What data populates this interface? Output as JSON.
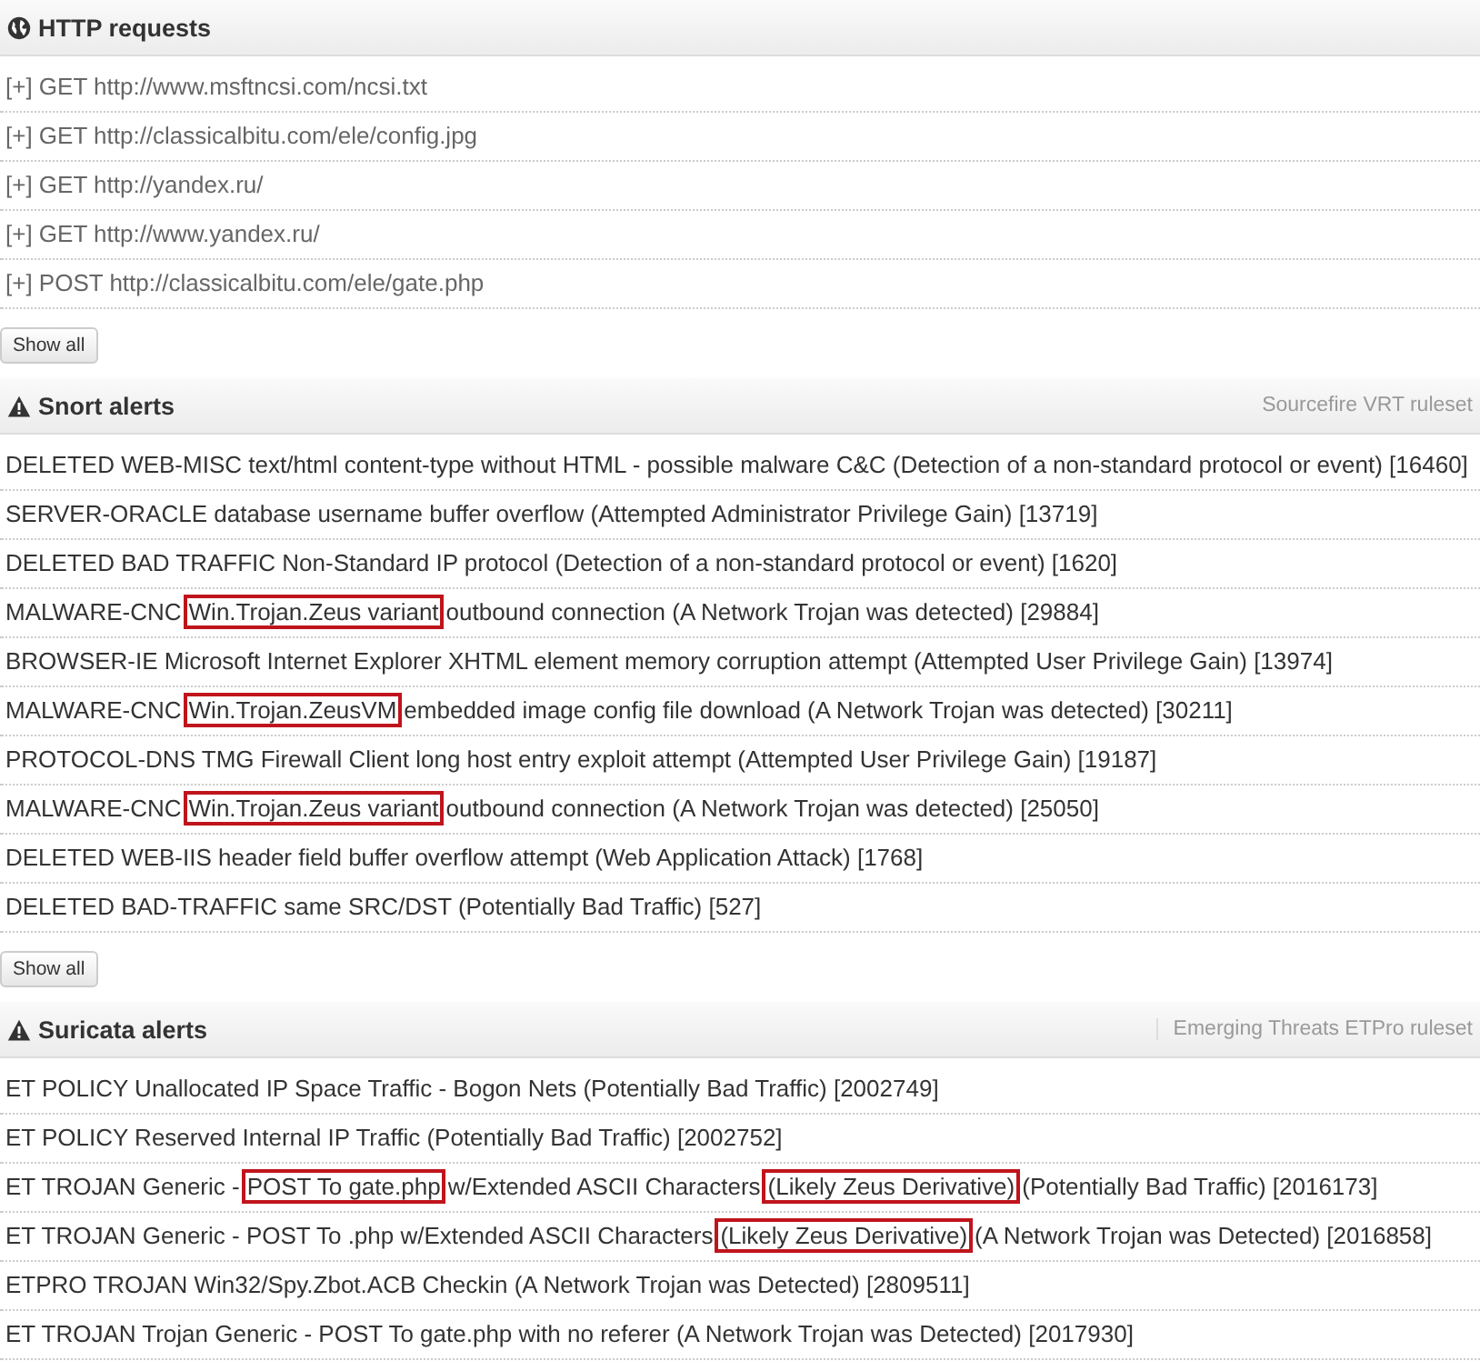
{
  "sections": [
    {
      "kind": "http",
      "title": "HTTP requests",
      "items": [
        {
          "parts": [
            {
              "text": "[+] GET http://www.msftncsi.com/ncsi.txt",
              "highlighted": false
            }
          ]
        },
        {
          "parts": [
            {
              "text": "[+] GET http://classicalbitu.com/ele/config.jpg",
              "highlighted": false
            }
          ]
        },
        {
          "parts": [
            {
              "text": "[+] GET http://yandex.ru/",
              "highlighted": false
            }
          ]
        },
        {
          "parts": [
            {
              "text": "[+] GET http://www.yandex.ru/",
              "highlighted": false
            }
          ]
        },
        {
          "parts": [
            {
              "text": "[+] POST http://classicalbitu.com/ele/gate.php",
              "highlighted": false
            }
          ]
        }
      ],
      "button": "Show all"
    },
    {
      "kind": "alerts",
      "title": "Snort alerts",
      "ruleset": "Sourcefire VRT ruleset",
      "items": [
        {
          "parts": [
            {
              "text": "DELETED WEB-MISC text/html content-type without HTML - possible malware C&C (Detection of a non-standard protocol or event) [16460]",
              "highlighted": false
            }
          ]
        },
        {
          "parts": [
            {
              "text": "SERVER-ORACLE database username buffer overflow (Attempted Administrator Privilege Gain) [13719]",
              "highlighted": false
            }
          ]
        },
        {
          "parts": [
            {
              "text": "DELETED BAD TRAFFIC Non-Standard IP protocol (Detection of a non-standard protocol or event) [1620]",
              "highlighted": false
            }
          ]
        },
        {
          "parts": [
            {
              "text": "MALWARE-CNC",
              "highlighted": false
            },
            {
              "text": "Win.Trojan.Zeus variant",
              "highlighted": true
            },
            {
              "text": "outbound connection (A Network Trojan was detected) [29884]",
              "highlighted": false
            }
          ]
        },
        {
          "parts": [
            {
              "text": "BROWSER-IE Microsoft Internet Explorer XHTML element memory corruption attempt (Attempted User Privilege Gain) [13974]",
              "highlighted": false
            }
          ]
        },
        {
          "parts": [
            {
              "text": "MALWARE-CNC",
              "highlighted": false
            },
            {
              "text": "Win.Trojan.ZeusVM",
              "highlighted": true
            },
            {
              "text": "embedded image config file download (A Network Trojan was detected) [30211]",
              "highlighted": false
            }
          ]
        },
        {
          "parts": [
            {
              "text": "PROTOCOL-DNS TMG Firewall Client long host entry exploit attempt (Attempted User Privilege Gain) [19187]",
              "highlighted": false
            }
          ]
        },
        {
          "parts": [
            {
              "text": "MALWARE-CNC",
              "highlighted": false
            },
            {
              "text": "Win.Trojan.Zeus variant",
              "highlighted": true
            },
            {
              "text": "outbound connection (A Network Trojan was detected) [25050]",
              "highlighted": false
            }
          ]
        },
        {
          "parts": [
            {
              "text": "DELETED WEB-IIS header field buffer overflow attempt (Web Application Attack) [1768]",
              "highlighted": false
            }
          ]
        },
        {
          "parts": [
            {
              "text": "DELETED BAD-TRAFFIC same SRC/DST (Potentially Bad Traffic) [527]",
              "highlighted": false
            }
          ]
        }
      ],
      "button": "Show all"
    },
    {
      "kind": "alerts",
      "title": "Suricata alerts",
      "ruleset": "Emerging Threats ETPro ruleset",
      "items": [
        {
          "parts": [
            {
              "text": "ET POLICY Unallocated IP Space Traffic - Bogon Nets (Potentially Bad Traffic) [2002749]",
              "highlighted": false
            }
          ]
        },
        {
          "parts": [
            {
              "text": "ET POLICY Reserved Internal IP Traffic (Potentially Bad Traffic) [2002752]",
              "highlighted": false
            }
          ]
        },
        {
          "parts": [
            {
              "text": "ET TROJAN Generic -",
              "highlighted": false
            },
            {
              "text": "POST To gate.php",
              "highlighted": true
            },
            {
              "text": "w/Extended ASCII Characters",
              "highlighted": false
            },
            {
              "text": "(Likely Zeus Derivative)",
              "highlighted": true
            },
            {
              "text": "(Potentially Bad Traffic) [2016173]",
              "highlighted": false
            }
          ]
        },
        {
          "parts": [
            {
              "text": "ET TROJAN Generic - POST To .php w/Extended ASCII Characters",
              "highlighted": false
            },
            {
              "text": "(Likely Zeus Derivative)",
              "highlighted": true
            },
            {
              "text": "(A Network Trojan was Detected) [2016858]",
              "highlighted": false
            }
          ]
        },
        {
          "parts": [
            {
              "text": "ETPRO TROJAN Win32/Spy.Zbot.ACB Checkin (A Network Trojan was Detected) [2809511]",
              "highlighted": false
            }
          ]
        },
        {
          "parts": [
            {
              "text": "ET TROJAN Trojan Generic - POST To gate.php with no referer (A Network Trojan was Detected) [2017930]",
              "highlighted": false
            }
          ]
        }
      ]
    }
  ]
}
